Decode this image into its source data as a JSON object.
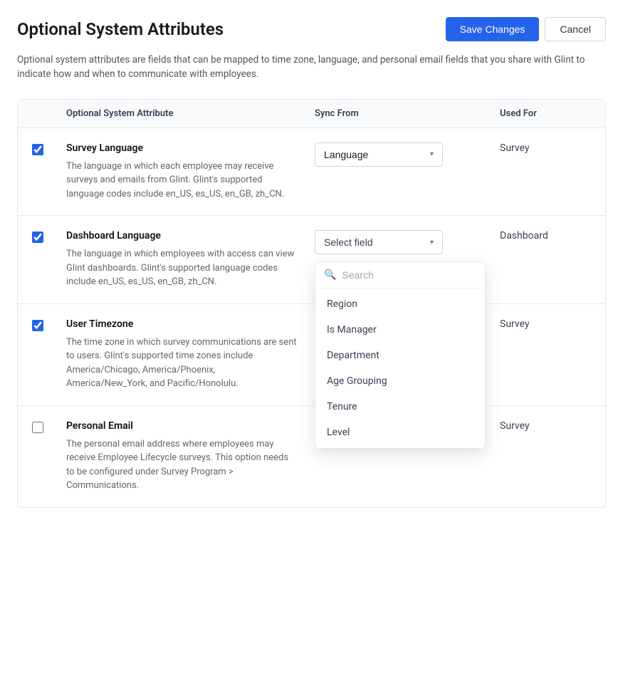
{
  "page": {
    "title": "Optional System Attributes",
    "description": "Optional system attributes are fields that can be mapped to time zone, language, and personal email fields that you share with Glint to indicate how and when to communicate with employees.",
    "save_label": "Save Changes",
    "cancel_label": "Cancel"
  },
  "table": {
    "headers": {
      "attribute": "Optional System Attribute",
      "sync_from": "Sync From",
      "used_for": "Used For"
    },
    "rows": [
      {
        "id": "survey-language",
        "name": "Survey Language",
        "description": "The language in which each employee may receive surveys and emails from Glint. Glint's supported language codes include en_US, es_US, en_GB, zh_CN.",
        "checked": true,
        "sync_value": "Language",
        "sync_type": "selected",
        "used_for": "Survey"
      },
      {
        "id": "dashboard-language",
        "name": "Dashboard Language",
        "description": "The language in which employees with access can view Glint dashboards. Glint's supported language codes include en_US, es_US, en_GB, zh_CN.",
        "checked": true,
        "sync_value": "Select field",
        "sync_type": "dropdown-open",
        "used_for": "Dashboard"
      },
      {
        "id": "user-timezone",
        "name": "User Timezone",
        "description": "The time zone in which survey communications are sent to users. Glint's supported time zones include America/Chicago, America/Phoenix, America/New_York, and Pacific/Honolulu.",
        "checked": true,
        "sync_value": "Select field",
        "sync_type": "placeholder",
        "used_for": "Survey"
      },
      {
        "id": "personal-email",
        "name": "Personal Email",
        "description": "The personal email address where employees may receive Employee Lifecycle surveys. This option needs to be configured under Survey Program > Communications.",
        "checked": false,
        "sync_value": "Select field",
        "sync_type": "placeholder",
        "used_for": "Survey"
      }
    ]
  },
  "dropdown": {
    "search_placeholder": "Search",
    "items": [
      "Region",
      "Is Manager",
      "Department",
      "Age Grouping",
      "Tenure",
      "Level"
    ]
  }
}
